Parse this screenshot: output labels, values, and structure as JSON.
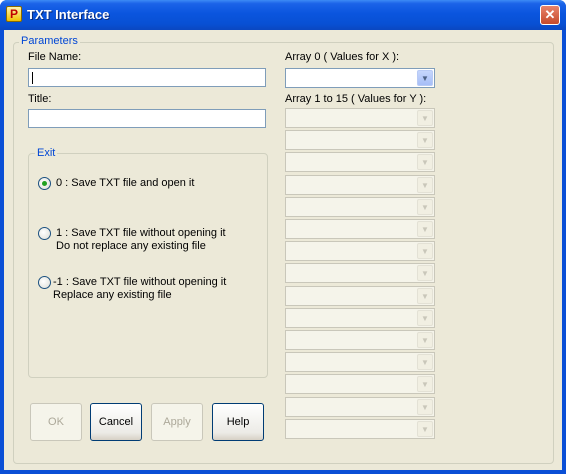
{
  "window": {
    "title": "TXT Interface",
    "close_glyph": "✕",
    "icon_glyph": "P"
  },
  "parameters": {
    "legend": "Parameters",
    "file_name_label": "File Name:",
    "file_name_value": "",
    "title_label": "Title:",
    "title_value": "",
    "array0_label": "Array 0 ( Values for X ):",
    "array0_value": "",
    "array_y_label": "Array 1 to 15 ( Values for Y ):",
    "array_y_slots": 15
  },
  "exit": {
    "legend": "Exit",
    "options": [
      {
        "line1": "0 : Save TXT file and open it",
        "line2": "",
        "checked": true
      },
      {
        "line1": "1 : Save TXT file without opening it",
        "line2": "Do not replace any existing file",
        "checked": false
      },
      {
        "line1": "-1 : Save TXT file without opening it",
        "line2": "Replace any existing file",
        "checked": false
      }
    ]
  },
  "buttons": {
    "ok": "OK",
    "cancel": "Cancel",
    "apply": "Apply",
    "help": "Help"
  },
  "icons": {
    "dropdown": "▼"
  }
}
